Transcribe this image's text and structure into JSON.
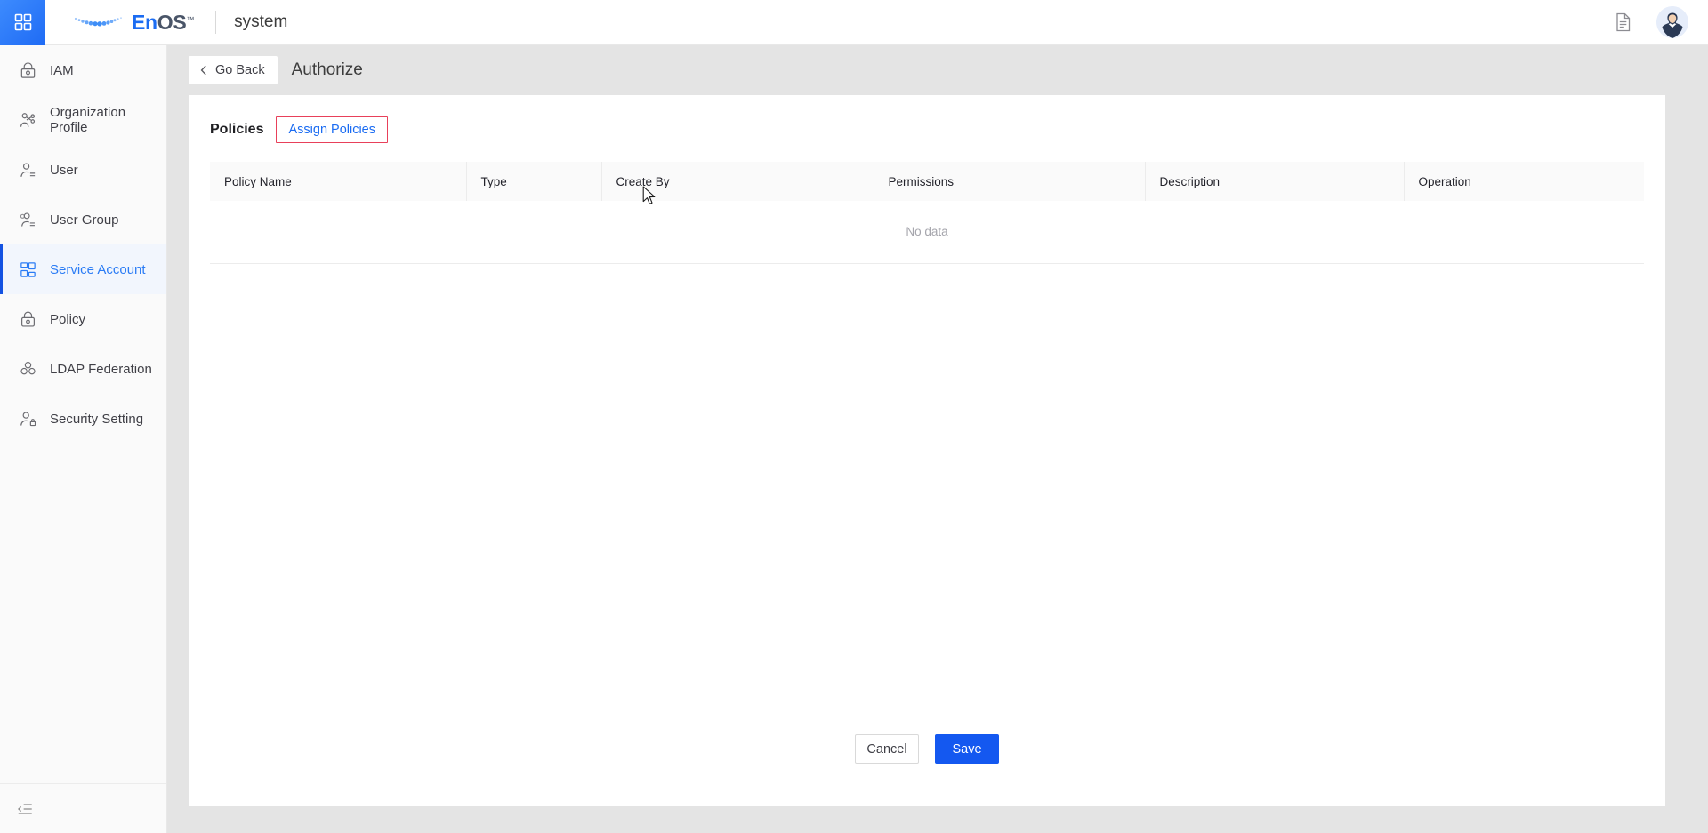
{
  "topbar": {
    "apps_icon": "apps-grid-icon",
    "brand_en": "En",
    "brand_os": "OS",
    "brand_tm": "™",
    "app_title": "system",
    "doc_icon": "document-icon",
    "avatar_icon": "user-avatar"
  },
  "sidebar": {
    "items": [
      {
        "label": "IAM",
        "icon": "iam-lock-icon",
        "active": false
      },
      {
        "label": "Organization Profile",
        "icon": "organization-icon",
        "active": false
      },
      {
        "label": "User",
        "icon": "user-icon",
        "active": false
      },
      {
        "label": "User Group",
        "icon": "user-group-icon",
        "active": false
      },
      {
        "label": "Service Account",
        "icon": "service-account-icon",
        "active": true
      },
      {
        "label": "Policy",
        "icon": "policy-lock-icon",
        "active": false
      },
      {
        "label": "LDAP Federation",
        "icon": "ldap-federation-icon",
        "active": false
      },
      {
        "label": "Security Setting",
        "icon": "security-setting-icon",
        "active": false
      }
    ],
    "collapse_icon": "collapse-sidebar-icon"
  },
  "header": {
    "go_back_label": "Go Back",
    "back_icon": "chevron-left-icon",
    "page_title": "Authorize"
  },
  "policies": {
    "section_label": "Policies",
    "assign_button_label": "Assign Policies",
    "assign_button_border_color": "#e8405a",
    "assign_button_text_color": "#1b6cf2"
  },
  "table": {
    "columns": [
      "Policy Name",
      "Type",
      "Create By",
      "Permissions",
      "Description",
      "Operation"
    ],
    "rows": [],
    "empty_text": "No data"
  },
  "actions": {
    "cancel_label": "Cancel",
    "save_label": "Save",
    "save_color": "#1458f0"
  },
  "colors": {
    "accent": "#1b6cf2",
    "page_background": "#e4e4e4",
    "card_background": "#ffffff",
    "sidebar_background": "#fafafa",
    "active_nav_background": "#f2f6fd",
    "active_nav_bar": "#1352e2"
  }
}
